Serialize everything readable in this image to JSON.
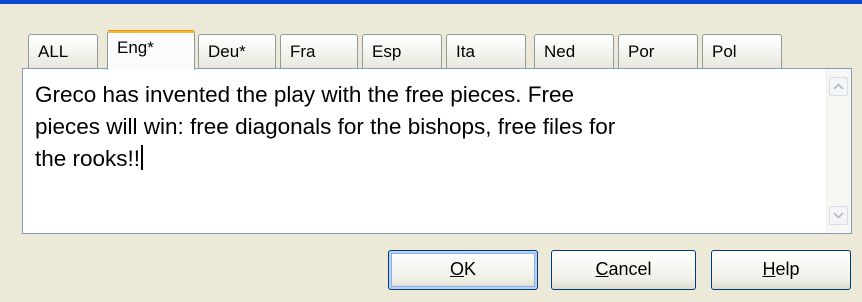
{
  "tabs": [
    {
      "label": "ALL",
      "active": false
    },
    {
      "label": "Eng*",
      "active": true
    },
    {
      "label": "Deu*",
      "active": false
    },
    {
      "label": "Fra",
      "active": false
    },
    {
      "label": "Esp",
      "active": false
    },
    {
      "label": "Ita",
      "active": false
    },
    {
      "label": "Ned",
      "active": false
    },
    {
      "label": "Por",
      "active": false
    },
    {
      "label": "Pol",
      "active": false
    }
  ],
  "editor": {
    "text": "Greco has invented the play with the free pieces. Free\npieces will win: free diagonals for the bishops, free files for\nthe rooks!!"
  },
  "buttons": {
    "ok": {
      "mnemonic": "O",
      "rest": "K"
    },
    "cancel": {
      "mnemonic": "C",
      "rest": "ancel"
    },
    "help": {
      "mnemonic": "H",
      "rest": "elp"
    }
  },
  "colors": {
    "active_tab_accent": "#f6b53b",
    "dialog_background": "#ece9d8",
    "title_bar_blue": "#0a4ad0"
  }
}
